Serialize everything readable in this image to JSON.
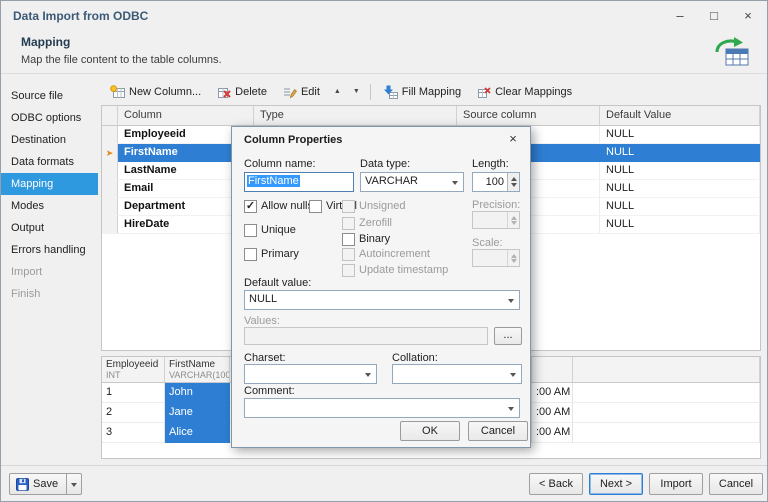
{
  "icons": {
    "minimize": "–",
    "maximize": "□",
    "close": "×",
    "dialog_close": "×",
    "current_row": "➤",
    "move_up": "▲",
    "move_down": "▼"
  },
  "window": {
    "title": "Data Import from ODBC"
  },
  "header": {
    "title": "Mapping",
    "subtitle": "Map the file content to the table columns."
  },
  "sidebar": {
    "items": [
      {
        "label": "Source file",
        "state": "normal"
      },
      {
        "label": "ODBC options",
        "state": "normal"
      },
      {
        "label": "Destination",
        "state": "normal"
      },
      {
        "label": "Data formats",
        "state": "normal"
      },
      {
        "label": "Mapping",
        "state": "selected"
      },
      {
        "label": "Modes",
        "state": "normal"
      },
      {
        "label": "Output",
        "state": "normal"
      },
      {
        "label": "Errors handling",
        "state": "normal"
      },
      {
        "label": "Import",
        "state": "disabled"
      },
      {
        "label": "Finish",
        "state": "disabled"
      }
    ]
  },
  "toolbar": {
    "new_column": "New Column...",
    "delete": "Delete",
    "edit": "Edit",
    "fill_mapping": "Fill Mapping",
    "clear_mappings": "Clear Mappings"
  },
  "mapping_table": {
    "headers": {
      "column": "Column",
      "type": "Type",
      "source": "Source column",
      "default": "Default Value"
    },
    "rows": [
      {
        "column": "Employeeid",
        "default": "NULL",
        "selected": false
      },
      {
        "column": "FirstName",
        "default": "NULL",
        "selected": true
      },
      {
        "column": "LastName",
        "default": "NULL",
        "selected": false
      },
      {
        "column": "Email",
        "default": "NULL",
        "selected": false
      },
      {
        "column": "Department",
        "default": "NULL",
        "selected": false
      },
      {
        "column": "HireDate",
        "default": "NULL",
        "selected": false
      }
    ]
  },
  "dialog": {
    "title": "Column Properties",
    "labels": {
      "column_name": "Column name:",
      "data_type": "Data type:",
      "length": "Length:",
      "precision": "Precision:",
      "scale": "Scale:",
      "default_value": "Default value:",
      "values": "Values:",
      "charset": "Charset:",
      "collation": "Collation:",
      "comment": "Comment:"
    },
    "values": {
      "column_name": "FirstName",
      "data_type": "VARCHAR",
      "length": "100",
      "default_value": "NULL",
      "browse": "..."
    },
    "checkboxes": {
      "allow_nulls": "Allow nulls",
      "virtual": "Virtual",
      "unique": "Unique",
      "primary": "Primary",
      "unsigned": "Unsigned",
      "zerofill": "Zerofill",
      "binary": "Binary",
      "autoincrement": "Autoincrement",
      "update_timestamp": "Update timestamp"
    },
    "checkbox_states": {
      "allow_nulls": {
        "checked": true,
        "disabled": false
      },
      "virtual": {
        "checked": false,
        "disabled": false
      },
      "unique": {
        "checked": false,
        "disabled": false
      },
      "primary": {
        "checked": false,
        "disabled": false
      },
      "unsigned": {
        "checked": false,
        "disabled": true
      },
      "zerofill": {
        "checked": false,
        "disabled": true
      },
      "binary": {
        "checked": false,
        "disabled": false
      },
      "autoincrement": {
        "checked": false,
        "disabled": true
      },
      "update_timestamp": {
        "checked": false,
        "disabled": true
      }
    },
    "buttons": {
      "ok": "OK",
      "cancel": "Cancel"
    }
  },
  "preview_grid": {
    "columns": [
      {
        "name": "Employeeid",
        "type": "INT"
      },
      {
        "name": "FirstName",
        "type": "VARCHAR(100)"
      }
    ],
    "rows": [
      {
        "id": "1",
        "first_name": "John",
        "fragment": ":00 AM"
      },
      {
        "id": "2",
        "first_name": "Jane",
        "fragment": ":00 AM"
      },
      {
        "id": "3",
        "first_name": "Alice",
        "fragment": ":00 AM"
      }
    ]
  },
  "footer": {
    "save": "Save",
    "back": "< Back",
    "next": "Next >",
    "import": "Import",
    "cancel": "Cancel"
  },
  "colors": {
    "accent": "#2e7fd4",
    "selection": "#3399ff",
    "sidebar_selected": "#2f99e0",
    "current_row_arrow": "#e08b1a"
  }
}
